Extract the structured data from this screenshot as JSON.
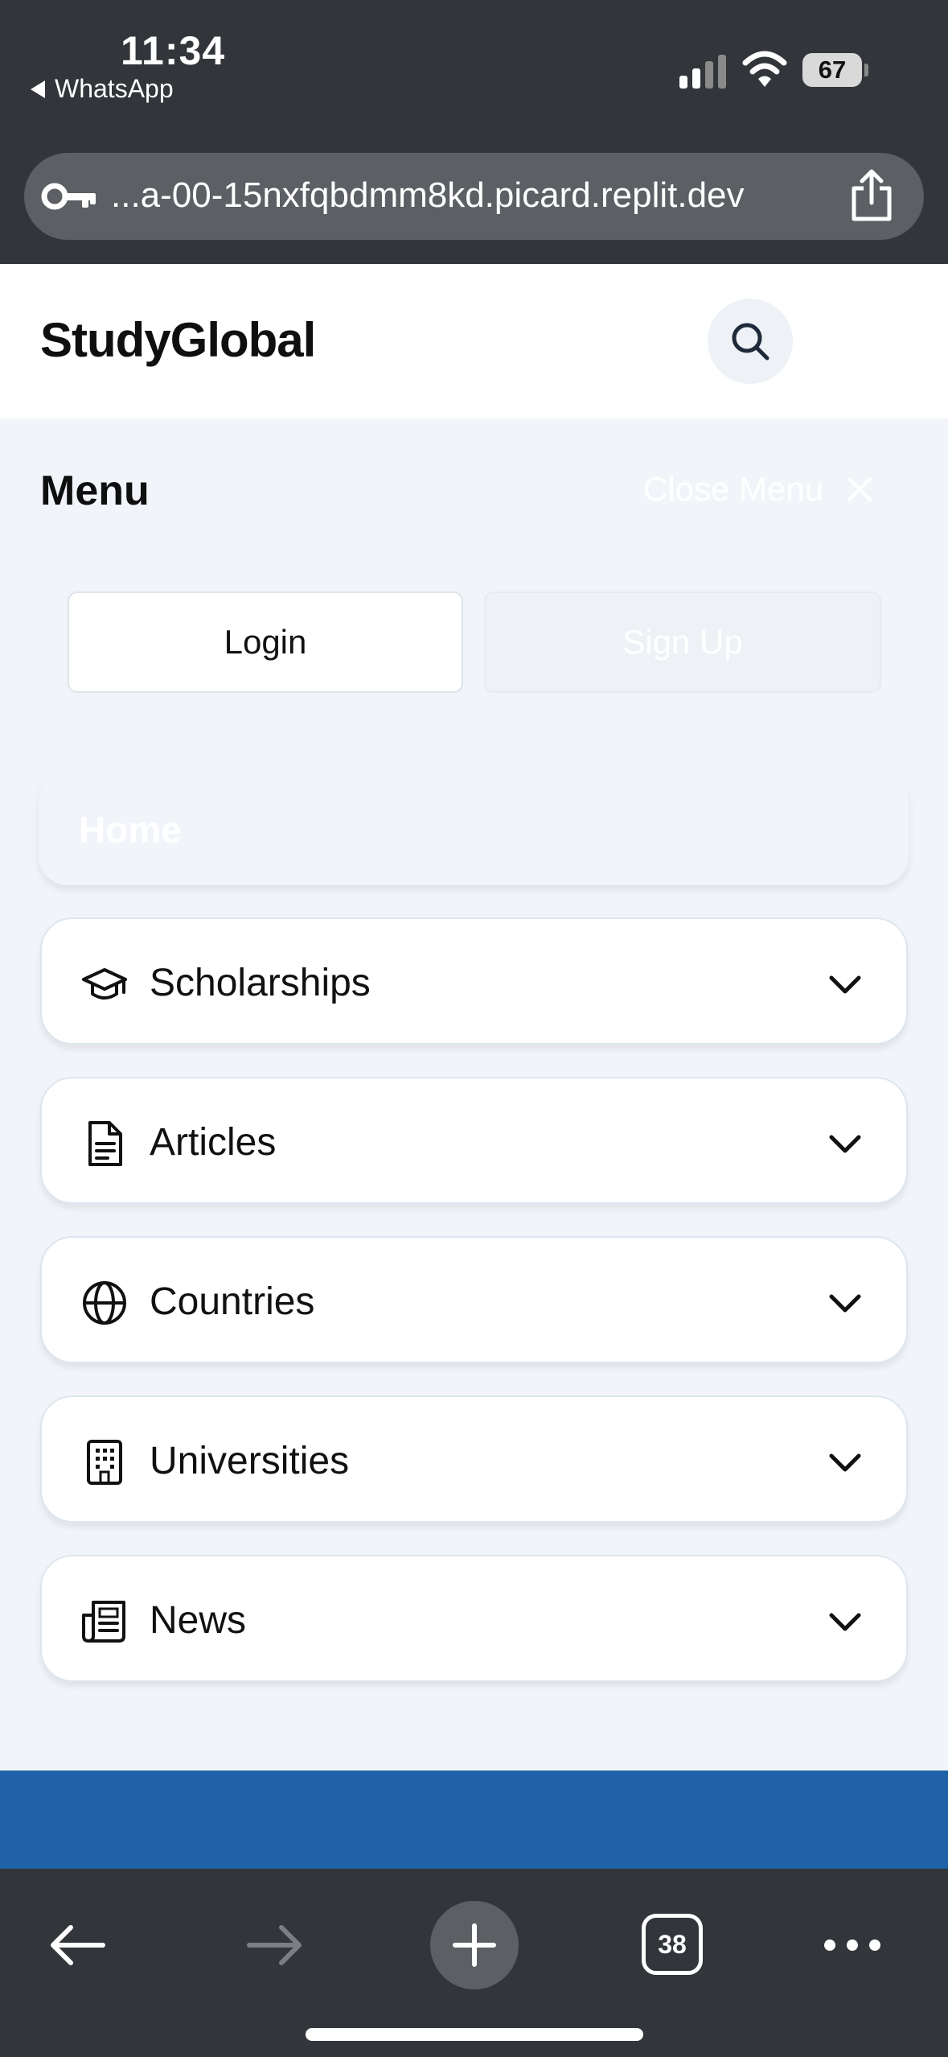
{
  "status_bar": {
    "time": "11:34",
    "back_app": "WhatsApp",
    "battery": "67"
  },
  "browser": {
    "url": "...a-00-15nxfqbdmm8kd.picard.replit.dev",
    "tab_count": "38"
  },
  "header": {
    "brand": "StudyGlobal"
  },
  "menu": {
    "title": "Menu",
    "close_label": "Close Menu",
    "login_label": "Login",
    "signup_label": "Sign Up",
    "home_label": "Home",
    "items": [
      {
        "label": "Scholarships",
        "icon": "graduation-cap-icon"
      },
      {
        "label": "Articles",
        "icon": "document-icon"
      },
      {
        "label": "Countries",
        "icon": "globe-icon"
      },
      {
        "label": "Universities",
        "icon": "building-icon"
      },
      {
        "label": "News",
        "icon": "newspaper-icon"
      }
    ]
  },
  "colors": {
    "chrome": "#32353a",
    "panel": "#f1f5f9",
    "accent_blue": "#1f62a8"
  }
}
